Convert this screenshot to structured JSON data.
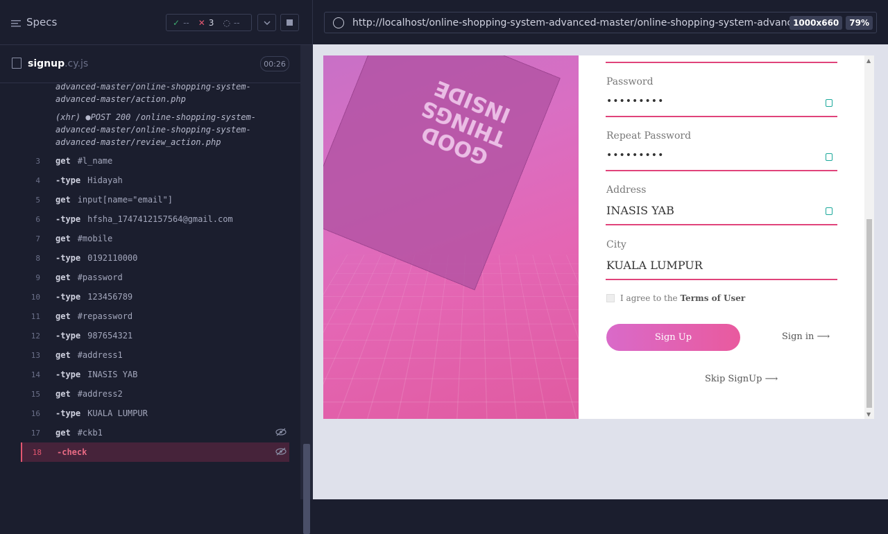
{
  "runner": {
    "title": "Specs",
    "stats": {
      "passed": "--",
      "failed": "3",
      "pending": "--"
    },
    "spec": {
      "name": "signup",
      "ext": ".cy.js",
      "duration": "00:26"
    }
  },
  "xhr_logs": [
    {
      "text": "advanced-master/online-shopping-system-advanced-master/action.php"
    },
    {
      "text": "(xhr) ●POST 200 /online-shopping-system-advanced-master/online-shopping-system-advanced-master/review_action.php"
    }
  ],
  "commands": [
    {
      "n": "3",
      "k": "get",
      "v": "#l_name"
    },
    {
      "n": "4",
      "k": "-type",
      "v": "Hidayah"
    },
    {
      "n": "5",
      "k": "get",
      "v": "input[name=\"email\"]"
    },
    {
      "n": "6",
      "k": "-type",
      "v": "hfsha_1747412157564@gmail.com"
    },
    {
      "n": "7",
      "k": "get",
      "v": "#mobile"
    },
    {
      "n": "8",
      "k": "-type",
      "v": "0192110000"
    },
    {
      "n": "9",
      "k": "get",
      "v": "#password"
    },
    {
      "n": "10",
      "k": "-type",
      "v": "123456789"
    },
    {
      "n": "11",
      "k": "get",
      "v": "#repassword"
    },
    {
      "n": "12",
      "k": "-type",
      "v": "987654321"
    },
    {
      "n": "13",
      "k": "get",
      "v": "#address1"
    },
    {
      "n": "14",
      "k": "-type",
      "v": "INASIS YAB"
    },
    {
      "n": "15",
      "k": "get",
      "v": "#address2"
    },
    {
      "n": "16",
      "k": "-type",
      "v": "KUALA LUMPUR"
    },
    {
      "n": "17",
      "k": "get",
      "v": "#ckb1"
    },
    {
      "n": "18",
      "k": "-check",
      "v": ""
    }
  ],
  "browser": {
    "url": "http://localhost/online-shopping-system-advanced-master/online-shopping-system-advanced-master",
    "viewport": "1000x660",
    "zoom": "79%"
  },
  "photo": {
    "bag_text": "GOOD THINGS INSIDE"
  },
  "form": {
    "password_label": "Password",
    "password_value": "•••••••••",
    "repeat_label": "Repeat Password",
    "repeat_value": "•••••••••",
    "address_label": "Address",
    "address_value": "INASIS YAB",
    "city_label": "City",
    "city_value": "KUALA LUMPUR",
    "agree_text": "I agree to the",
    "terms": "Terms of User",
    "signup": "Sign Up",
    "signin": "Sign in ⟶",
    "skip": "Skip SignUp ⟶"
  }
}
